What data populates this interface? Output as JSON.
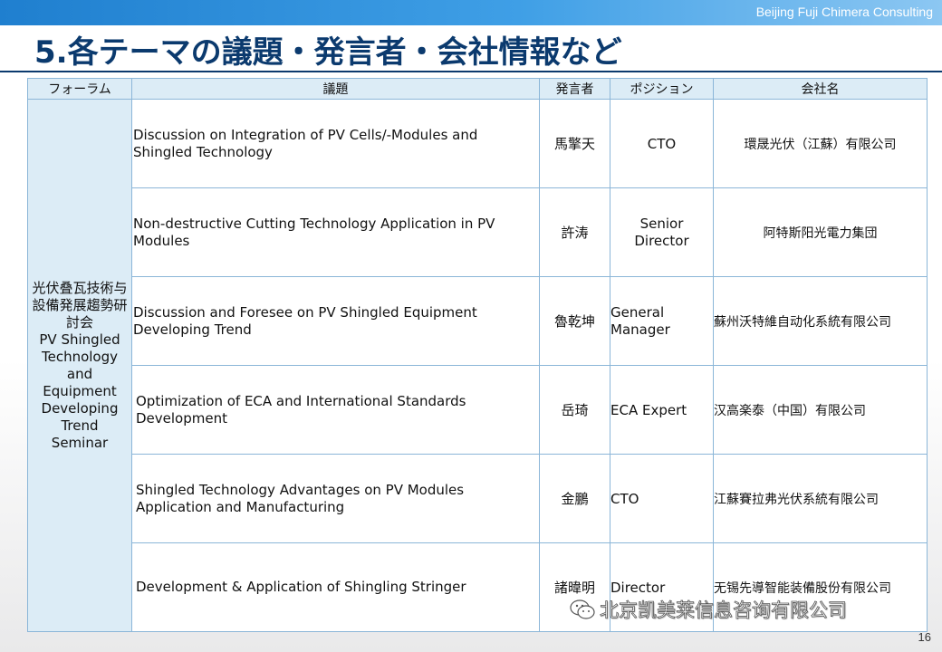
{
  "header": {
    "brand": "Beijing Fuji Chimera Consulting",
    "title": "5.各テーマの議題・発言者・会社情報など"
  },
  "table": {
    "columns": [
      "フォーラム",
      "議題",
      "発言者",
      "ポジション",
      "会社名"
    ],
    "forum_ja": "光伏叠瓦技術与設備発展趨勢研討会",
    "forum_en": "PV Shingled Technology and Equipment Developing Trend Seminar",
    "rows": [
      {
        "topic": "Discussion on Integration of PV Cells/-Modules and Shingled Technology",
        "speaker": "馬擎天",
        "position": "CTO",
        "company": "環晟光伏（江蘇）有限公司"
      },
      {
        "topic": "Non-destructive Cutting Technology Application in PV Modules",
        "speaker": "許涛",
        "position": "Senior Director",
        "company": "阿特斯阳光電力集団"
      },
      {
        "topic": "Discussion and Foresee on PV Shingled Equipment Developing Trend",
        "speaker": "魯乾坤",
        "position": "General Manager",
        "company": "蘇州沃特維自动化系統有限公司"
      },
      {
        "topic": "Optimization of ECA and International Standards Development",
        "speaker": "岳琦",
        "position": "ECA Expert",
        "company": "汉高楽泰（中国）有限公司"
      },
      {
        "topic": "Shingled Technology Advantages on PV Modules Application and Manufacturing",
        "speaker": "金鵬",
        "position": "CTO",
        "company": "江蘇賽拉弗光伏系統有限公司"
      },
      {
        "topic": "Development & Application of Shingling Stringer",
        "speaker": "諸暐明",
        "position": "Director",
        "company": "无锡先導智能装備股份有限公司"
      }
    ]
  },
  "watermark": {
    "text": "北京凯美莱信息咨询有限公司",
    "icon": "wechat-icon"
  },
  "footer": {
    "page_number": "16"
  }
}
